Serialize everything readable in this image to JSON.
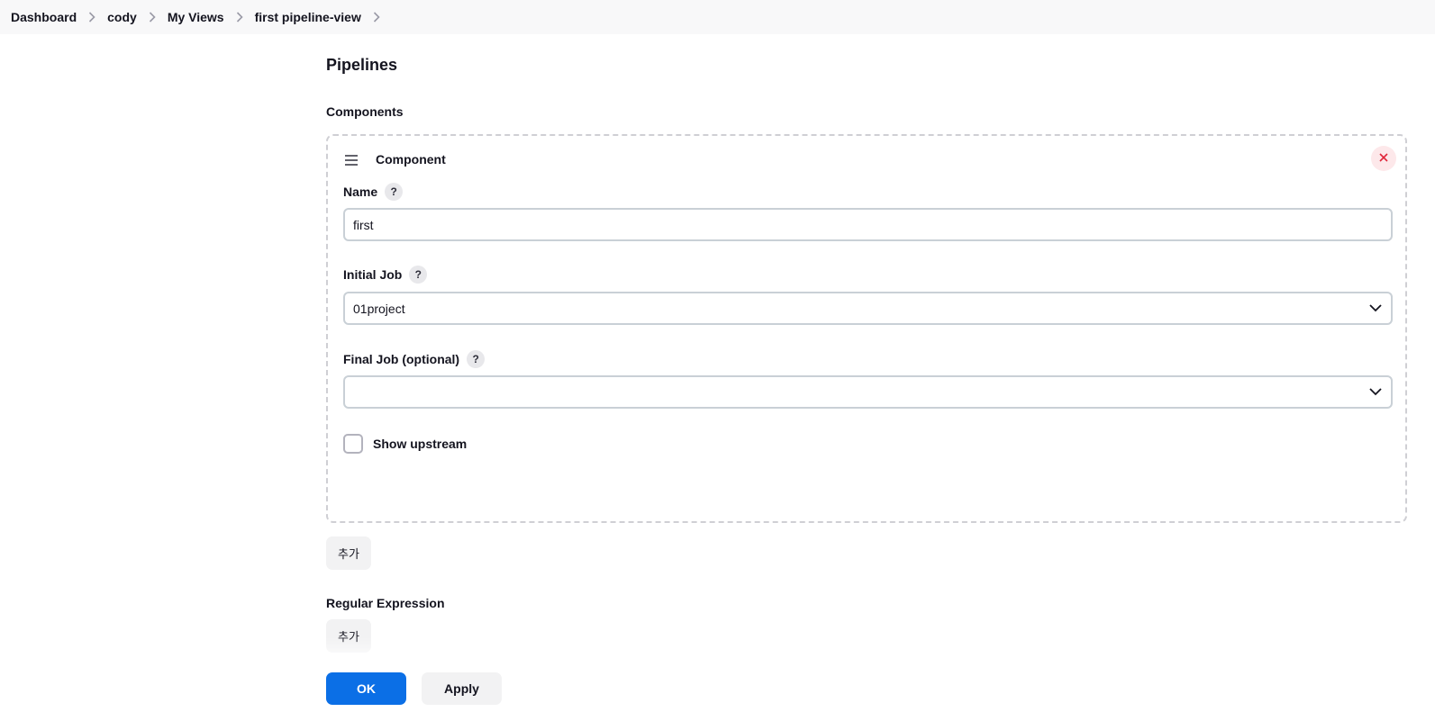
{
  "breadcrumb": {
    "items": [
      {
        "label": "Dashboard"
      },
      {
        "label": "cody"
      },
      {
        "label": "My Views"
      },
      {
        "label": "first pipeline-view"
      }
    ],
    "separator_icon": "chevron-right-icon"
  },
  "main": {
    "section_title": "Pipelines",
    "components_label": "Components",
    "component": {
      "title": "Component",
      "drag_icon": "drag-handle-icon",
      "remove_icon": "close-icon",
      "name": {
        "label": "Name",
        "help": "?",
        "value": "first"
      },
      "initial_job": {
        "label": "Initial Job",
        "help": "?",
        "selected": "01project"
      },
      "final_job": {
        "label": "Final Job (optional)",
        "help": "?",
        "selected": ""
      },
      "show_upstream": {
        "label": "Show upstream",
        "checked": false
      }
    },
    "add_component_label": "추가",
    "regex_label": "Regular Expression",
    "add_regex_label": "추가"
  },
  "footer": {
    "ok_label": "OK",
    "apply_label": "Apply"
  },
  "colors": {
    "accent": "#0b6fe6",
    "danger": "#e0263a",
    "danger_bg": "#fde8ea"
  }
}
